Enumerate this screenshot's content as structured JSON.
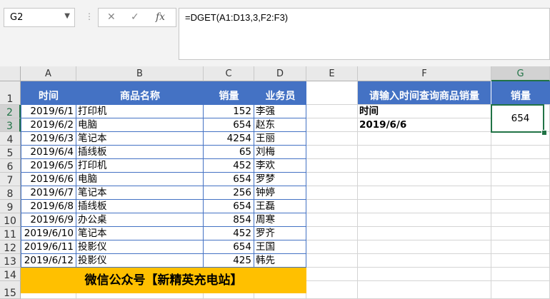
{
  "name_box": "G2",
  "formula": "=DGET(A1:D13,3,F2:F3)",
  "columns": [
    "A",
    "B",
    "C",
    "D",
    "E",
    "F",
    "G"
  ],
  "rows": [
    "1",
    "2",
    "3",
    "4",
    "5",
    "6",
    "7",
    "8",
    "9",
    "10",
    "11",
    "12",
    "13",
    "14",
    "15"
  ],
  "table_headers": {
    "time": "时间",
    "name": "商品名称",
    "qty": "销量",
    "staff": "业务员"
  },
  "table_rows": [
    {
      "date": "2019/6/1",
      "item": "打印机",
      "qty": "152",
      "staff": "李强"
    },
    {
      "date": "2019/6/2",
      "item": "电脑",
      "qty": "654",
      "staff": "赵东"
    },
    {
      "date": "2019/6/3",
      "item": "笔记本",
      "qty": "4254",
      "staff": "王丽"
    },
    {
      "date": "2019/6/4",
      "item": "插线板",
      "qty": "65",
      "staff": "刘梅"
    },
    {
      "date": "2019/6/5",
      "item": "打印机",
      "qty": "452",
      "staff": "李欢"
    },
    {
      "date": "2019/6/6",
      "item": "电脑",
      "qty": "654",
      "staff": "罗梦"
    },
    {
      "date": "2019/6/7",
      "item": "笔记本",
      "qty": "256",
      "staff": "钟婷"
    },
    {
      "date": "2019/6/8",
      "item": "插线板",
      "qty": "654",
      "staff": "王磊"
    },
    {
      "date": "2019/6/9",
      "item": "办公桌",
      "qty": "854",
      "staff": "周寒"
    },
    {
      "date": "2019/6/10",
      "item": "笔记本",
      "qty": "452",
      "staff": "罗齐"
    },
    {
      "date": "2019/6/11",
      "item": "投影仪",
      "qty": "654",
      "staff": "王国"
    },
    {
      "date": "2019/6/12",
      "item": "投影仪",
      "qty": "425",
      "staff": "韩先"
    }
  ],
  "banner": "微信公众号【新精英充电站】",
  "query": {
    "header": "请输入时间查询商品销量",
    "result_header": "销量",
    "criteria_label": "时间",
    "criteria_value": "2019/6/6",
    "result": "654"
  },
  "colors": {
    "header_bg": "#4472c4",
    "banner_bg": "#ffc000",
    "selection": "#217346"
  }
}
